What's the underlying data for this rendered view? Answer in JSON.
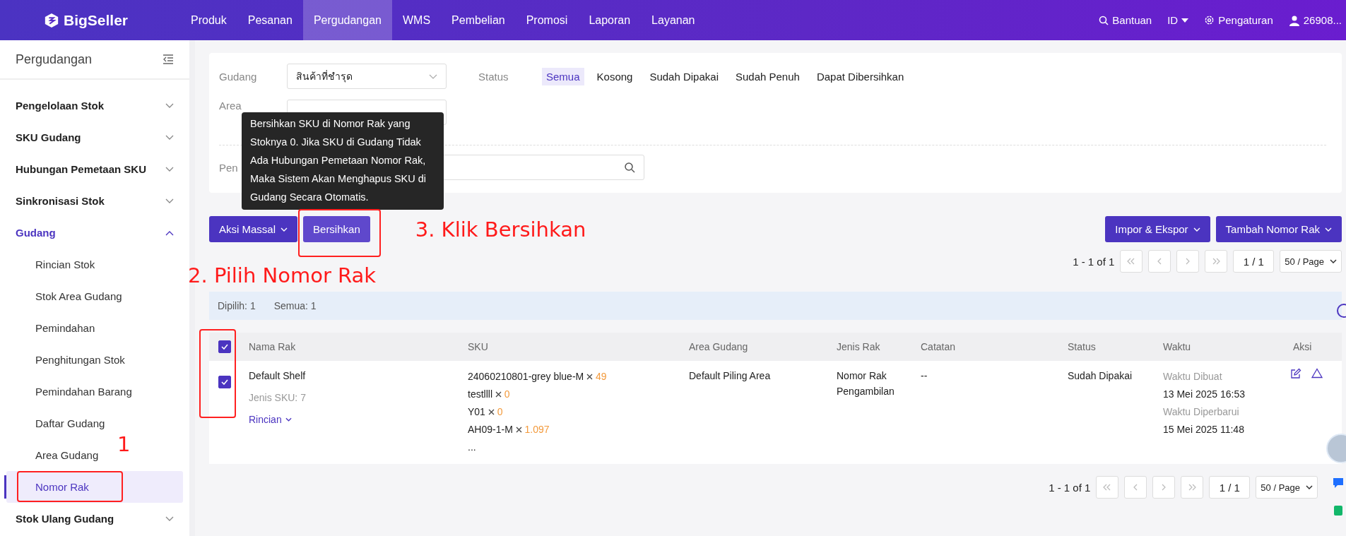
{
  "topbar": {
    "logo": "BigSeller",
    "nav": [
      {
        "label": "Produk",
        "selected": false
      },
      {
        "label": "Pesanan",
        "selected": false
      },
      {
        "label": "Pergudangan",
        "selected": true
      },
      {
        "label": "WMS",
        "selected": false
      },
      {
        "label": "Pembelian",
        "selected": false
      },
      {
        "label": "Promosi",
        "selected": false
      },
      {
        "label": "Laporan",
        "selected": false
      },
      {
        "label": "Layanan",
        "selected": false
      }
    ],
    "help": "Bantuan",
    "language": "ID",
    "settings": "Pengaturan",
    "user": "26908..."
  },
  "sidebar": {
    "title": "Pergudangan",
    "groups": [
      {
        "label": "Pengelolaan Stok",
        "expanded": false
      },
      {
        "label": "SKU Gudang",
        "expanded": false
      },
      {
        "label": "Hubungan Pemetaan SKU",
        "expanded": false
      },
      {
        "label": "Sinkronisasi Stok",
        "expanded": false
      },
      {
        "label": "Gudang",
        "expanded": true,
        "children": [
          {
            "label": "Rincian Stok",
            "selected": false
          },
          {
            "label": "Stok Area Gudang",
            "selected": false
          },
          {
            "label": "Pemindahan",
            "selected": false
          },
          {
            "label": "Penghitungan Stok",
            "selected": false
          },
          {
            "label": "Pemindahan Barang",
            "selected": false
          },
          {
            "label": "Daftar Gudang",
            "selected": false
          },
          {
            "label": "Area Gudang",
            "selected": false
          },
          {
            "label": "Nomor Rak",
            "selected": true
          }
        ]
      },
      {
        "label": "Stok Ulang Gudang",
        "expanded": false
      }
    ]
  },
  "filters": {
    "warehouse_label": "Gudang",
    "warehouse_value": "สินค้าที่ชำรุด",
    "status_label": "Status",
    "statuses": [
      {
        "label": "Semua",
        "selected": true
      },
      {
        "label": "Kosong",
        "selected": false
      },
      {
        "label": "Sudah Dipakai",
        "selected": false
      },
      {
        "label": "Sudah Penuh",
        "selected": false
      },
      {
        "label": "Dapat Dibersihkan",
        "selected": false
      }
    ],
    "area_label": "Area",
    "search_label": "Pen"
  },
  "tooltip": "Bersihkan SKU di Nomor Rak yang Stoknya 0. Jika SKU di Gudang Tidak Ada Hubungan Pemetaan Nomor Rak, Maka Sistem Akan Menghapus SKU di Gudang Secara Otomatis.",
  "toolbar": {
    "bulk_action": "Aksi Massal",
    "clear": "Bersihkan",
    "import_export": "Impor & Ekspor",
    "add_shelf": "Tambah Nomor Rak"
  },
  "pagination_top": {
    "range": "1 - 1 of 1",
    "page": "1 / 1",
    "per_page": "50 / Page"
  },
  "selection": {
    "selected": "Dipilih: 1",
    "total": "Semua: 1"
  },
  "table": {
    "all_checked": true,
    "columns": [
      "Nama Rak",
      "SKU",
      "Area Gudang",
      "Jenis Rak",
      "Catatan",
      "Status",
      "Waktu",
      "Aksi"
    ],
    "rows": [
      {
        "checked": true,
        "name": "Default Shelf",
        "sku_types": "Jenis SKU: 7",
        "detail": "Rincian",
        "skus": [
          {
            "code": "24060210801-grey blue-M",
            "qty": "49"
          },
          {
            "code": "testllll",
            "qty": "0"
          },
          {
            "code": "Y01",
            "qty": "0"
          },
          {
            "code": "AH09-1-M",
            "qty": "1.097"
          }
        ],
        "more": "...",
        "area": "Default Piling Area",
        "type": "Nomor Rak Pengambilan",
        "note": "--",
        "status": "Sudah Dipakai",
        "created_label": "Waktu Dibuat",
        "created": "13 Mei 2025 16:53",
        "updated_label": "Waktu Diperbarui",
        "updated": "15 Mei 2025 11:48"
      }
    ]
  },
  "pagination_bottom": {
    "range": "1 - 1 of 1",
    "page": "1 / 1",
    "per_page": "50 / Page"
  },
  "annotations": {
    "step_menu": "1",
    "step_select": "2. Pilih Nomor Rak",
    "step_click": "3. Klik Bersihkan"
  }
}
